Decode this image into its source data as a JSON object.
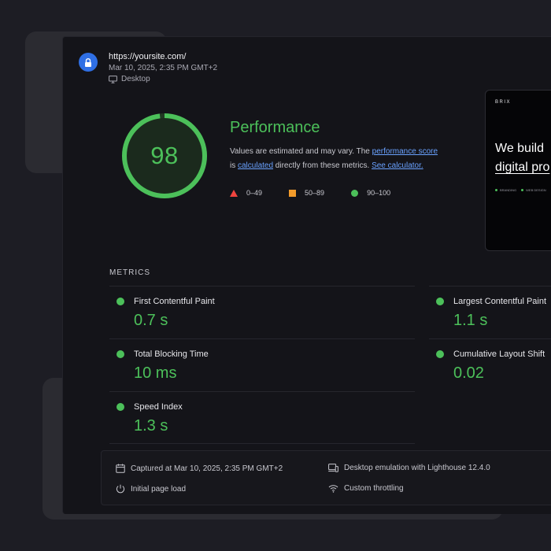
{
  "header": {
    "url": "https://yoursite.com/",
    "date": "Mar 10, 2025, 2:35 PM GMT+2",
    "device": "Desktop"
  },
  "performance": {
    "score": "98",
    "score_value": 98,
    "title": "Performance",
    "desc_prefix": "Values are estimated and may vary. The ",
    "link_score": "performance score",
    "desc_is": " is ",
    "link_calculated": "calculated",
    "desc_mid": " directly from these metrics. ",
    "link_calculator": "See calculator.",
    "legend": [
      {
        "shape": "triangle",
        "label": "0–49",
        "color": "#f0443e"
      },
      {
        "shape": "square",
        "label": "50–89",
        "color": "#f39b2b"
      },
      {
        "shape": "circle",
        "label": "90–100",
        "color": "#4cc05a"
      }
    ],
    "color": "#4cc05a"
  },
  "thumbnail": {
    "brand": "BRIX",
    "headline_line1": "We build",
    "headline_line2": "digital pro",
    "tags": [
      "BRANDING",
      "WEB DESIGN"
    ]
  },
  "metrics": {
    "title": "METRICS",
    "items": [
      {
        "name": "First Contentful Paint",
        "value": "0.7 s"
      },
      {
        "name": "Largest Contentful Paint",
        "value": "1.1 s"
      },
      {
        "name": "Total Blocking Time",
        "value": "10 ms"
      },
      {
        "name": "Cumulative Layout Shift",
        "value": "0.02"
      },
      {
        "name": "Speed Index",
        "value": "1.3 s"
      }
    ]
  },
  "footer": {
    "captured": "Captured at Mar 10, 2025, 2:35 PM GMT+2",
    "emulation": "Desktop emulation with Lighthouse 12.4.0",
    "load": "Initial page load",
    "throttling": "Custom throttling"
  }
}
